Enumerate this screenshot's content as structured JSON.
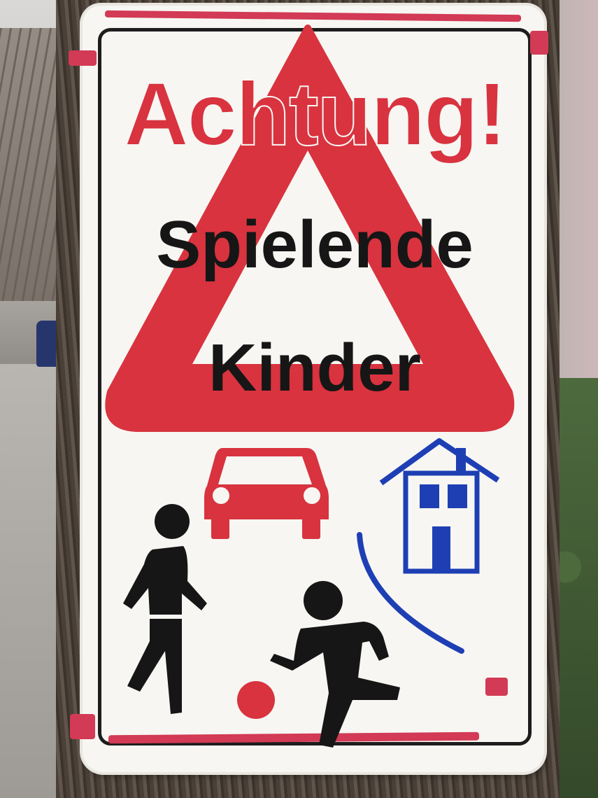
{
  "sign": {
    "heading": "Achtung!",
    "line1": "Spielende",
    "line2": "Kinder"
  },
  "colors": {
    "red": "#d8333f",
    "black": "#161616",
    "blue": "#1e3fb4",
    "white": "#f7f6f2"
  },
  "icons": [
    "warning-triangle-icon",
    "car-icon",
    "house-icon",
    "walking-person-icon",
    "running-child-icon",
    "ball-icon",
    "road-curve-icon"
  ]
}
